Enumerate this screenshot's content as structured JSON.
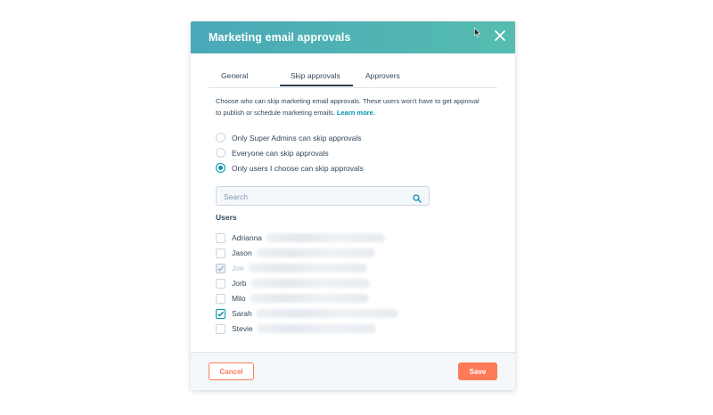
{
  "modal": {
    "title": "Marketing email approvals",
    "close_icon": "close-icon"
  },
  "tabs": [
    {
      "label": "General",
      "active": false
    },
    {
      "label": "Skip approvals",
      "active": true
    },
    {
      "label": "Approvers",
      "active": false
    }
  ],
  "description": {
    "text": "Choose who can skip marketing email approvals. These users won't have to get approval to publish or schedule marketing emails.",
    "link": "Learn more."
  },
  "options": [
    {
      "label": "Only Super Admins can skip approvals",
      "selected": false
    },
    {
      "label": "Everyone can skip approvals",
      "selected": false
    },
    {
      "label": "Only users I choose can skip approvals",
      "selected": true
    }
  ],
  "search": {
    "placeholder": "Search",
    "value": "",
    "icon": "search-icon"
  },
  "users": {
    "label": "Users",
    "list": [
      {
        "name": "Adrianna",
        "checked": false,
        "disabled": false
      },
      {
        "name": "Jason",
        "checked": false,
        "disabled": false
      },
      {
        "name": "Joe",
        "checked": true,
        "disabled": true
      },
      {
        "name": "Jorb",
        "checked": false,
        "disabled": false
      },
      {
        "name": "Milo",
        "checked": false,
        "disabled": false
      },
      {
        "name": "Sarah",
        "checked": true,
        "disabled": false
      },
      {
        "name": "Stevie",
        "checked": false,
        "disabled": false
      }
    ]
  },
  "footer": {
    "cancel_label": "Cancel",
    "save_label": "Save"
  },
  "colors": {
    "header_gradient_start": "#4aa8b8",
    "header_gradient_end": "#55bdb0",
    "accent": "#0091ae",
    "primary_button": "#ff7a59",
    "text": "#33475b"
  }
}
